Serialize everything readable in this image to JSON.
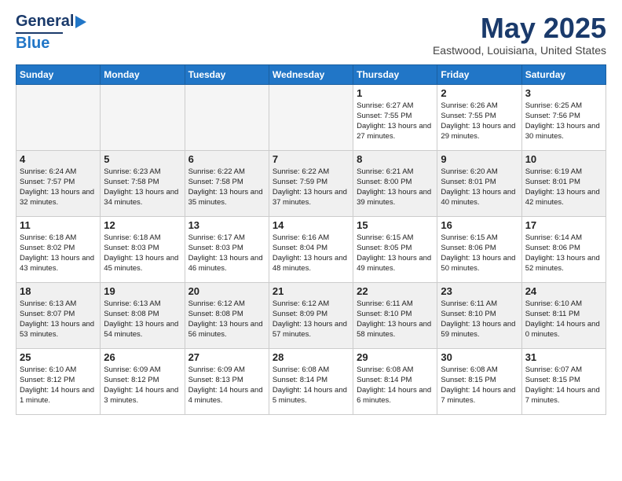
{
  "header": {
    "logo_general": "General",
    "logo_blue": "Blue",
    "title": "May 2025",
    "location": "Eastwood, Louisiana, United States"
  },
  "days_of_week": [
    "Sunday",
    "Monday",
    "Tuesday",
    "Wednesday",
    "Thursday",
    "Friday",
    "Saturday"
  ],
  "weeks": [
    [
      {
        "day": "",
        "empty": true
      },
      {
        "day": "",
        "empty": true
      },
      {
        "day": "",
        "empty": true
      },
      {
        "day": "",
        "empty": true
      },
      {
        "day": "1",
        "sunrise": "6:27 AM",
        "sunset": "7:55 PM",
        "daylight": "13 hours and 27 minutes."
      },
      {
        "day": "2",
        "sunrise": "6:26 AM",
        "sunset": "7:55 PM",
        "daylight": "13 hours and 29 minutes."
      },
      {
        "day": "3",
        "sunrise": "6:25 AM",
        "sunset": "7:56 PM",
        "daylight": "13 hours and 30 minutes."
      }
    ],
    [
      {
        "day": "4",
        "sunrise": "6:24 AM",
        "sunset": "7:57 PM",
        "daylight": "13 hours and 32 minutes."
      },
      {
        "day": "5",
        "sunrise": "6:23 AM",
        "sunset": "7:58 PM",
        "daylight": "13 hours and 34 minutes."
      },
      {
        "day": "6",
        "sunrise": "6:22 AM",
        "sunset": "7:58 PM",
        "daylight": "13 hours and 35 minutes."
      },
      {
        "day": "7",
        "sunrise": "6:22 AM",
        "sunset": "7:59 PM",
        "daylight": "13 hours and 37 minutes."
      },
      {
        "day": "8",
        "sunrise": "6:21 AM",
        "sunset": "8:00 PM",
        "daylight": "13 hours and 39 minutes."
      },
      {
        "day": "9",
        "sunrise": "6:20 AM",
        "sunset": "8:01 PM",
        "daylight": "13 hours and 40 minutes."
      },
      {
        "day": "10",
        "sunrise": "6:19 AM",
        "sunset": "8:01 PM",
        "daylight": "13 hours and 42 minutes."
      }
    ],
    [
      {
        "day": "11",
        "sunrise": "6:18 AM",
        "sunset": "8:02 PM",
        "daylight": "13 hours and 43 minutes."
      },
      {
        "day": "12",
        "sunrise": "6:18 AM",
        "sunset": "8:03 PM",
        "daylight": "13 hours and 45 minutes."
      },
      {
        "day": "13",
        "sunrise": "6:17 AM",
        "sunset": "8:03 PM",
        "daylight": "13 hours and 46 minutes."
      },
      {
        "day": "14",
        "sunrise": "6:16 AM",
        "sunset": "8:04 PM",
        "daylight": "13 hours and 48 minutes."
      },
      {
        "day": "15",
        "sunrise": "6:15 AM",
        "sunset": "8:05 PM",
        "daylight": "13 hours and 49 minutes."
      },
      {
        "day": "16",
        "sunrise": "6:15 AM",
        "sunset": "8:06 PM",
        "daylight": "13 hours and 50 minutes."
      },
      {
        "day": "17",
        "sunrise": "6:14 AM",
        "sunset": "8:06 PM",
        "daylight": "13 hours and 52 minutes."
      }
    ],
    [
      {
        "day": "18",
        "sunrise": "6:13 AM",
        "sunset": "8:07 PM",
        "daylight": "13 hours and 53 minutes."
      },
      {
        "day": "19",
        "sunrise": "6:13 AM",
        "sunset": "8:08 PM",
        "daylight": "13 hours and 54 minutes."
      },
      {
        "day": "20",
        "sunrise": "6:12 AM",
        "sunset": "8:08 PM",
        "daylight": "13 hours and 56 minutes."
      },
      {
        "day": "21",
        "sunrise": "6:12 AM",
        "sunset": "8:09 PM",
        "daylight": "13 hours and 57 minutes."
      },
      {
        "day": "22",
        "sunrise": "6:11 AM",
        "sunset": "8:10 PM",
        "daylight": "13 hours and 58 minutes."
      },
      {
        "day": "23",
        "sunrise": "6:11 AM",
        "sunset": "8:10 PM",
        "daylight": "13 hours and 59 minutes."
      },
      {
        "day": "24",
        "sunrise": "6:10 AM",
        "sunset": "8:11 PM",
        "daylight": "14 hours and 0 minutes."
      }
    ],
    [
      {
        "day": "25",
        "sunrise": "6:10 AM",
        "sunset": "8:12 PM",
        "daylight": "14 hours and 1 minute."
      },
      {
        "day": "26",
        "sunrise": "6:09 AM",
        "sunset": "8:12 PM",
        "daylight": "14 hours and 3 minutes."
      },
      {
        "day": "27",
        "sunrise": "6:09 AM",
        "sunset": "8:13 PM",
        "daylight": "14 hours and 4 minutes."
      },
      {
        "day": "28",
        "sunrise": "6:08 AM",
        "sunset": "8:14 PM",
        "daylight": "14 hours and 5 minutes."
      },
      {
        "day": "29",
        "sunrise": "6:08 AM",
        "sunset": "8:14 PM",
        "daylight": "14 hours and 6 minutes."
      },
      {
        "day": "30",
        "sunrise": "6:08 AM",
        "sunset": "8:15 PM",
        "daylight": "14 hours and 7 minutes."
      },
      {
        "day": "31",
        "sunrise": "6:07 AM",
        "sunset": "8:15 PM",
        "daylight": "14 hours and 7 minutes."
      }
    ]
  ]
}
